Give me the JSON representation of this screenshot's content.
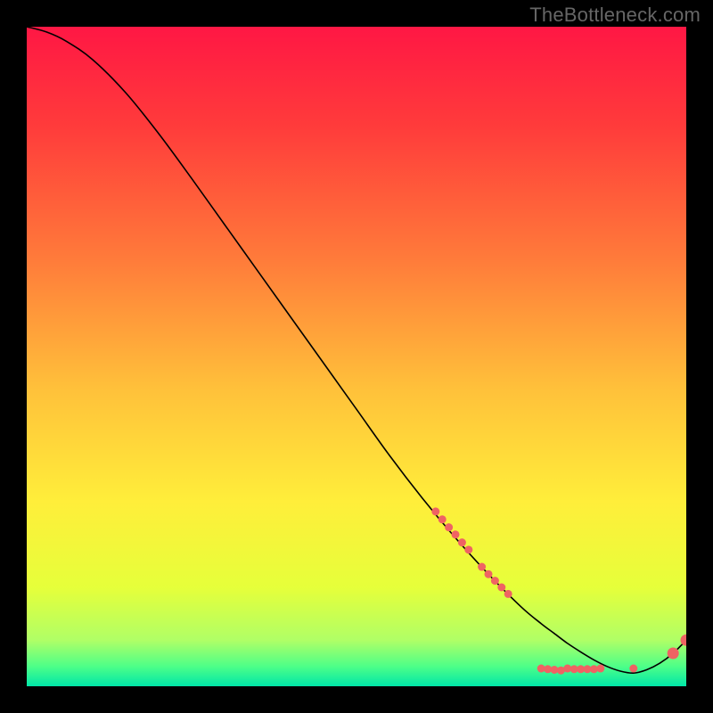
{
  "watermark": "TheBottleneck.com",
  "chart_data": {
    "type": "line",
    "title": "",
    "xlabel": "",
    "ylabel": "",
    "xlim": [
      0,
      100
    ],
    "ylim": [
      0,
      100
    ],
    "grid": false,
    "legend": false,
    "background_gradient": {
      "stops": [
        {
          "offset": 0.0,
          "color": "#ff1744"
        },
        {
          "offset": 0.15,
          "color": "#ff3b3b"
        },
        {
          "offset": 0.35,
          "color": "#ff7a3a"
        },
        {
          "offset": 0.55,
          "color": "#ffc13a"
        },
        {
          "offset": 0.72,
          "color": "#ffee3a"
        },
        {
          "offset": 0.85,
          "color": "#e6ff3a"
        },
        {
          "offset": 0.93,
          "color": "#b0ff66"
        },
        {
          "offset": 0.97,
          "color": "#4dff88"
        },
        {
          "offset": 1.0,
          "color": "#00e6a8"
        }
      ]
    },
    "series": [
      {
        "name": "curve",
        "color": "#000000",
        "x": [
          0,
          3,
          6,
          10,
          15,
          20,
          25,
          30,
          35,
          40,
          45,
          50,
          55,
          60,
          65,
          70,
          75,
          78,
          80,
          82,
          84,
          86,
          88,
          90,
          92,
          94,
          96,
          98,
          100
        ],
        "y": [
          100,
          99.2,
          97.8,
          95.0,
          90.0,
          83.8,
          77.0,
          70.0,
          63.0,
          56.0,
          49.0,
          42.0,
          35.0,
          28.5,
          22.5,
          17.0,
          12.0,
          9.5,
          8.0,
          6.5,
          5.2,
          4.0,
          3.0,
          2.3,
          2.0,
          2.5,
          3.5,
          5.0,
          7.0
        ]
      }
    ],
    "marker_points": {
      "name": "markers",
      "color": "#ef6363",
      "radius_small": 4.5,
      "radius_large": 6.5,
      "points": [
        {
          "x": 62,
          "y": 26.5,
          "r": "small"
        },
        {
          "x": 63,
          "y": 25.3,
          "r": "small"
        },
        {
          "x": 64,
          "y": 24.1,
          "r": "small"
        },
        {
          "x": 65,
          "y": 23.0,
          "r": "small"
        },
        {
          "x": 66,
          "y": 21.8,
          "r": "small"
        },
        {
          "x": 67,
          "y": 20.7,
          "r": "small"
        },
        {
          "x": 69,
          "y": 18.1,
          "r": "small"
        },
        {
          "x": 70,
          "y": 17.0,
          "r": "small"
        },
        {
          "x": 71,
          "y": 16.0,
          "r": "small"
        },
        {
          "x": 72,
          "y": 15.0,
          "r": "small"
        },
        {
          "x": 73,
          "y": 14.0,
          "r": "small"
        },
        {
          "x": 78,
          "y": 2.7,
          "r": "small"
        },
        {
          "x": 79,
          "y": 2.6,
          "r": "small"
        },
        {
          "x": 80,
          "y": 2.5,
          "r": "small"
        },
        {
          "x": 81,
          "y": 2.4,
          "r": "small"
        },
        {
          "x": 82,
          "y": 2.7,
          "r": "small"
        },
        {
          "x": 83,
          "y": 2.6,
          "r": "small"
        },
        {
          "x": 84,
          "y": 2.6,
          "r": "small"
        },
        {
          "x": 85,
          "y": 2.6,
          "r": "small"
        },
        {
          "x": 86,
          "y": 2.6,
          "r": "small"
        },
        {
          "x": 87,
          "y": 2.7,
          "r": "small"
        },
        {
          "x": 92,
          "y": 2.7,
          "r": "small"
        },
        {
          "x": 98,
          "y": 5.0,
          "r": "large"
        },
        {
          "x": 100,
          "y": 7.0,
          "r": "large"
        }
      ]
    }
  }
}
